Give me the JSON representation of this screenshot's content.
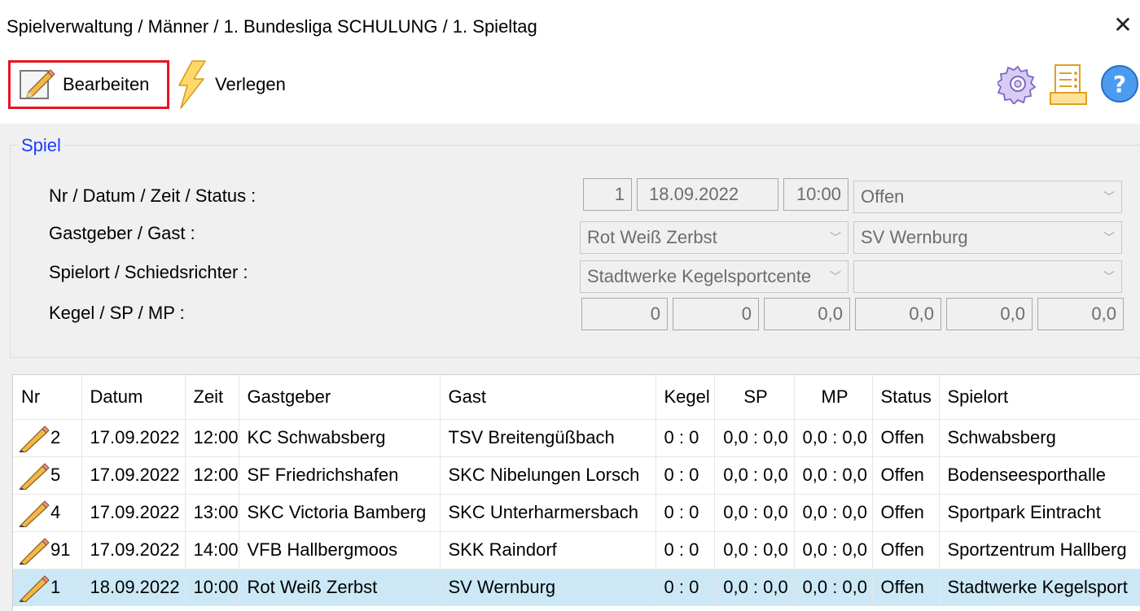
{
  "window": {
    "title": "Spielverwaltung / Männer / 1. Bundesliga SCHULUNG / 1. Spieltag",
    "close_label": "✕"
  },
  "toolbar": {
    "edit_label": "Bearbeiten",
    "move_label": "Verlegen"
  },
  "group": {
    "legend": "Spiel",
    "labels": {
      "row1": "Nr / Datum / Zeit / Status :",
      "row2": "Gastgeber / Gast :",
      "row3": "Spielort / Schiedsrichter :",
      "row4": "Kegel / SP / MP :"
    },
    "fields": {
      "nr": "1",
      "datum": "18.09.2022",
      "zeit": "10:00",
      "status": "Offen",
      "gastgeber": "Rot Weiß Zerbst",
      "gast": "SV Wernburg",
      "spielort": "Stadtwerke Kegelsportcente",
      "schiedsrichter": "",
      "kegel_home": "0",
      "kegel_away": "0",
      "sp_home": "0,0",
      "sp_away": "0,0",
      "mp_home": "0,0",
      "mp_away": "0,0"
    }
  },
  "table": {
    "columns": [
      "Nr",
      "Datum",
      "Zeit",
      "Gastgeber",
      "Gast",
      "Kegel",
      "SP",
      "MP",
      "Status",
      "Spielort"
    ],
    "rows": [
      {
        "nr": "2",
        "datum": "17.09.2022",
        "zeit": "12:00",
        "gastgeber": "KC Schwabsberg",
        "gast": "TSV Breitengüßbach",
        "kegel": "0 : 0",
        "sp": "0,0 : 0,0",
        "mp": "0,0 : 0,0",
        "status": "Offen",
        "spielort": "Schwabsberg"
      },
      {
        "nr": "5",
        "datum": "17.09.2022",
        "zeit": "12:00",
        "gastgeber": "SF Friedrichshafen",
        "gast": "SKC Nibelungen Lorsch",
        "kegel": "0 : 0",
        "sp": "0,0 : 0,0",
        "mp": "0,0 : 0,0",
        "status": "Offen",
        "spielort": "Bodenseesporthalle"
      },
      {
        "nr": "4",
        "datum": "17.09.2022",
        "zeit": "13:00",
        "gastgeber": "SKC Victoria Bamberg",
        "gast": "SKC Unterharmersbach",
        "kegel": "0 : 0",
        "sp": "0,0 : 0,0",
        "mp": "0,0 : 0,0",
        "status": "Offen",
        "spielort": "Sportpark Eintracht"
      },
      {
        "nr": "91",
        "datum": "17.09.2022",
        "zeit": "14:00",
        "gastgeber": "VFB Hallbergmoos",
        "gast": "SKK Raindorf",
        "kegel": "0 : 0",
        "sp": "0,0 : 0,0",
        "mp": "0,0 : 0,0",
        "status": "Offen",
        "spielort": "Sportzentrum Hallberg"
      },
      {
        "nr": "1",
        "datum": "18.09.2022",
        "zeit": "10:00",
        "gastgeber": "Rot Weiß Zerbst",
        "gast": "SV Wernburg",
        "kegel": "0 : 0",
        "sp": "0,0 : 0,0",
        "mp": "0,0 : 0,0",
        "status": "Offen",
        "spielort": "Stadtwerke Kegelsport"
      }
    ],
    "selected_row": 4
  },
  "colors": {
    "highlight_border": "#e8141e",
    "legend": "#1a3cff",
    "selected_row": "#cce8f7"
  }
}
